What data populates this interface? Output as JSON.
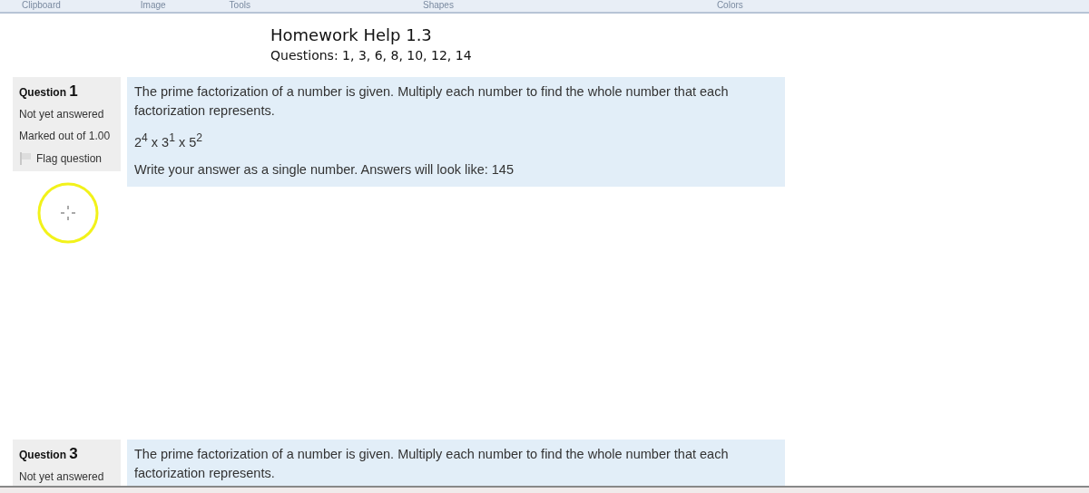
{
  "ribbon": {
    "groups": [
      "Clipboard",
      "Image",
      "Tools",
      "Shapes",
      "Colors"
    ]
  },
  "page": {
    "title": "Homework Help 1.3",
    "subtitle": "Questions: 1, 3, 6, 8, 10, 12, 14"
  },
  "questions": [
    {
      "label": "Question",
      "number": "1",
      "status": "Not yet answered",
      "marks": "Marked out of 1.00",
      "flag": "Flag question",
      "paragraphs": [
        "The prime factorization of a number is given. Multiply each number to find the whole number that each factorization represents.",
        "2$^{4}$ x 3$^{1}$ x 5$^{2}$",
        "Write your answer as a single number. Answers will look like: 145"
      ]
    },
    {
      "label": "Question",
      "number": "3",
      "status": "Not yet answered",
      "paragraphs": [
        "The prime factorization of a number is given. Multiply each number to find the whole number that each factorization represents."
      ]
    }
  ]
}
